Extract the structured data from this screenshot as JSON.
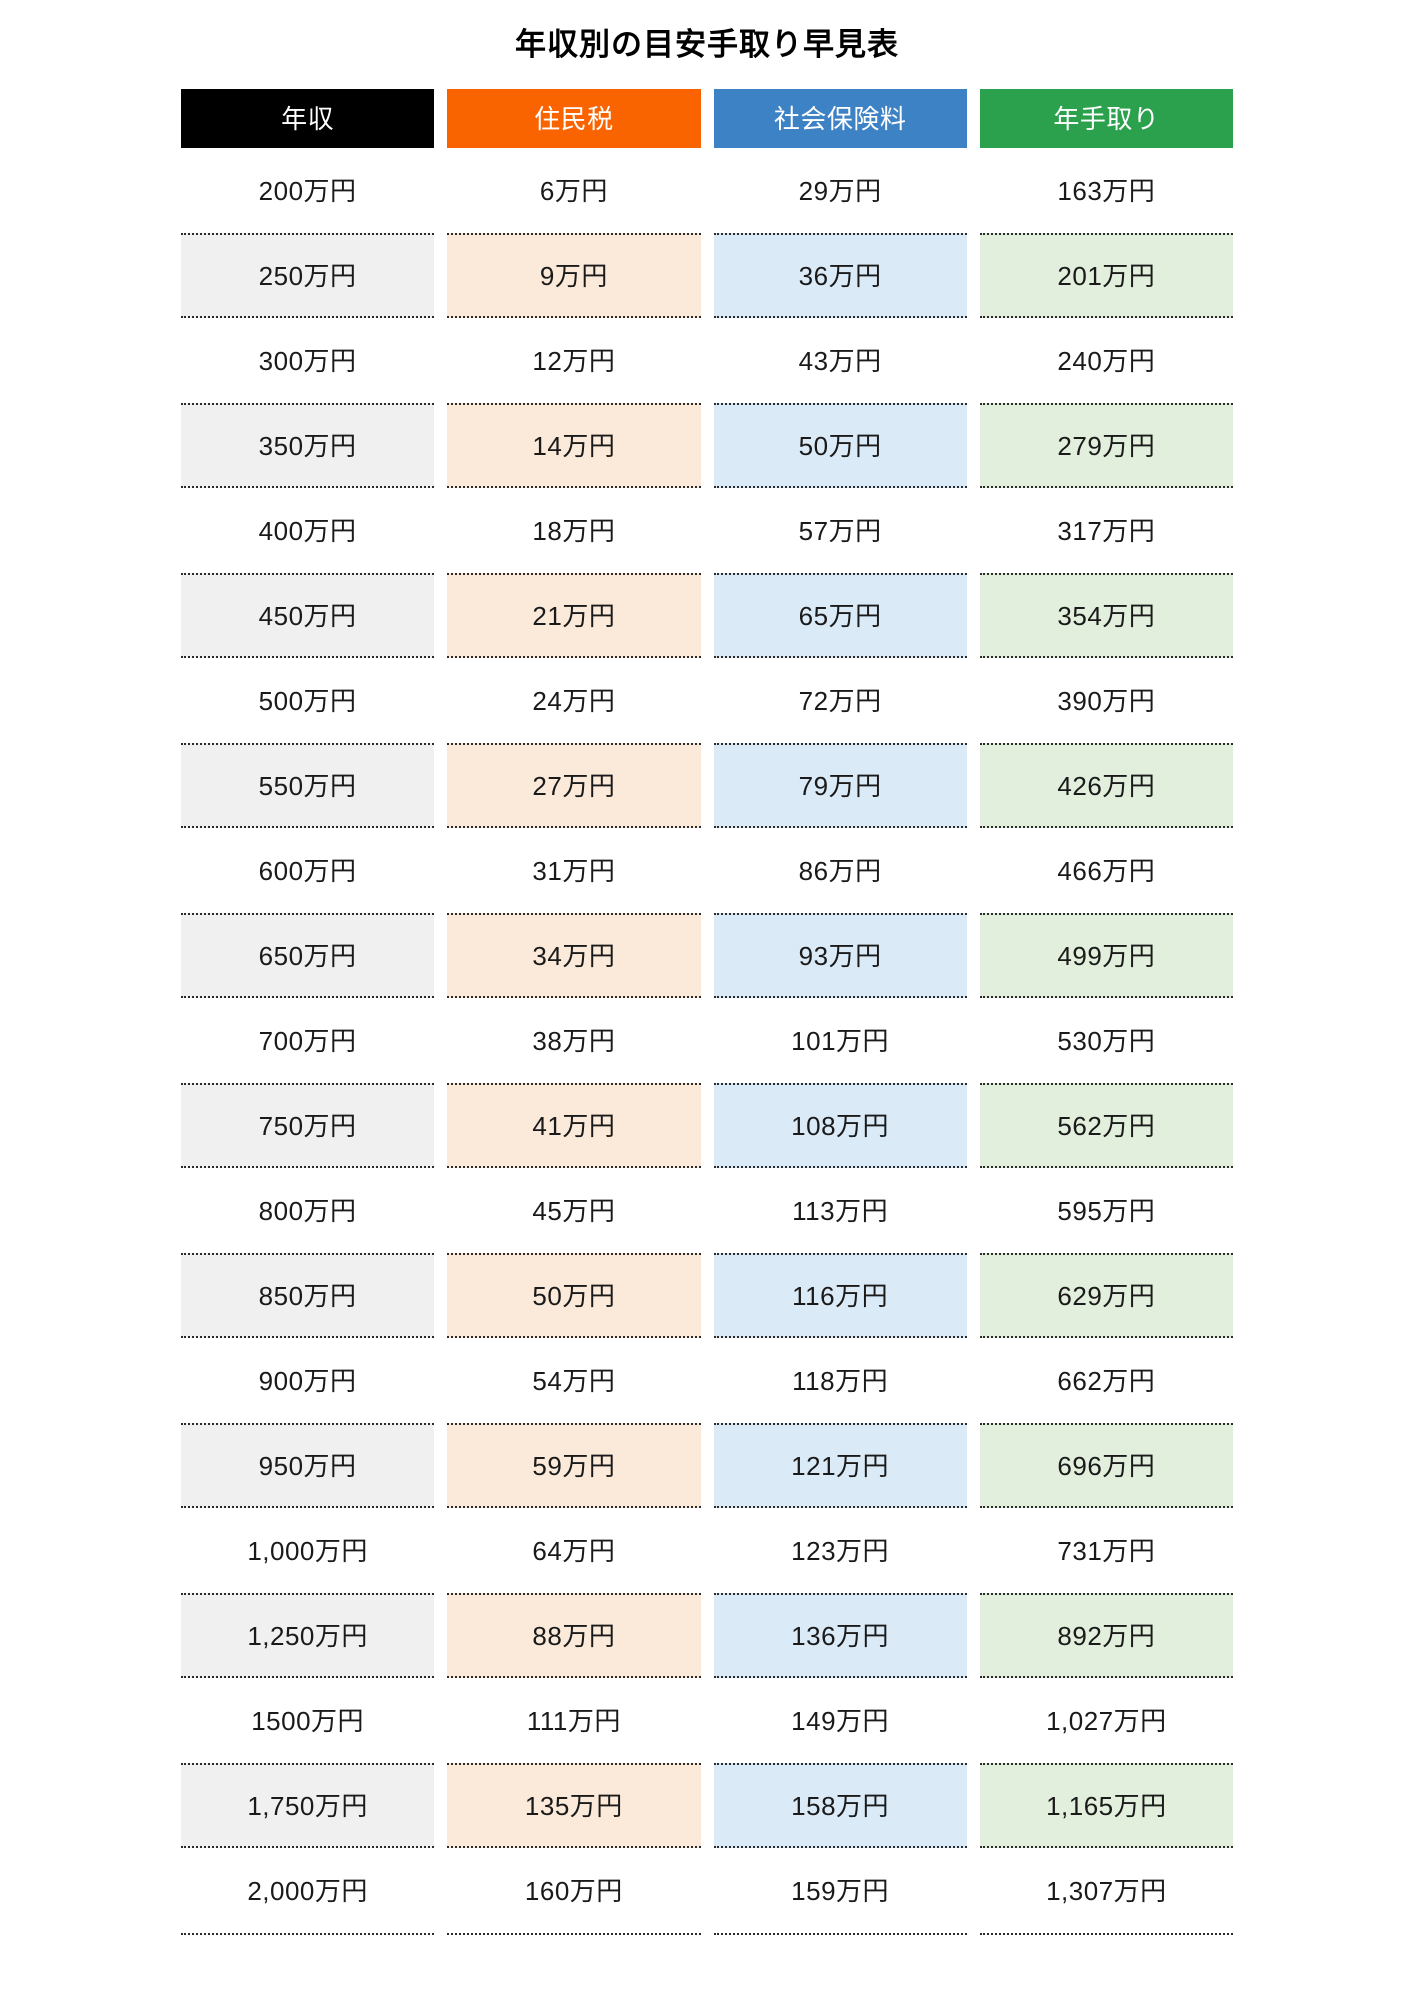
{
  "title": "年収別の目安手取り早見表",
  "colors": {
    "header_income": "#000000",
    "header_resident_tax": "#FA6400",
    "header_social_insurance": "#3C82C4",
    "header_takehome": "#2BA14E",
    "tint_income": "#f0f0f0",
    "tint_resident_tax": "#fbead9",
    "tint_social_insurance": "#dbeaf7",
    "tint_takehome": "#e2efdc",
    "text": "#1a1a1a",
    "background": "#ffffff"
  },
  "table": {
    "headers": [
      "年収",
      "住民税",
      "社会保険料",
      "年手取り"
    ],
    "rows": [
      [
        "200万円",
        "6万円",
        "29万円",
        "163万円"
      ],
      [
        "250万円",
        "9万円",
        "36万円",
        "201万円"
      ],
      [
        "300万円",
        "12万円",
        "43万円",
        "240万円"
      ],
      [
        "350万円",
        "14万円",
        "50万円",
        "279万円"
      ],
      [
        "400万円",
        "18万円",
        "57万円",
        "317万円"
      ],
      [
        "450万円",
        "21万円",
        "65万円",
        "354万円"
      ],
      [
        "500万円",
        "24万円",
        "72万円",
        "390万円"
      ],
      [
        "550万円",
        "27万円",
        "79万円",
        "426万円"
      ],
      [
        "600万円",
        "31万円",
        "86万円",
        "466万円"
      ],
      [
        "650万円",
        "34万円",
        "93万円",
        "499万円"
      ],
      [
        "700万円",
        "38万円",
        "101万円",
        "530万円"
      ],
      [
        "750万円",
        "41万円",
        "108万円",
        "562万円"
      ],
      [
        "800万円",
        "45万円",
        "113万円",
        "595万円"
      ],
      [
        "850万円",
        "50万円",
        "116万円",
        "629万円"
      ],
      [
        "900万円",
        "54万円",
        "118万円",
        "662万円"
      ],
      [
        "950万円",
        "59万円",
        "121万円",
        "696万円"
      ],
      [
        "1,000万円",
        "64万円",
        "123万円",
        "731万円"
      ],
      [
        "1,250万円",
        "88万円",
        "136万円",
        "892万円"
      ],
      [
        "1500万円",
        "111万円",
        "149万円",
        "1,027万円"
      ],
      [
        "1,750万円",
        "135万円",
        "158万円",
        "1,165万円"
      ],
      [
        "2,000万円",
        "160万円",
        "159万円",
        "1,307万円"
      ]
    ]
  },
  "chart_data": {
    "type": "table",
    "title": "年収別の目安手取り早見表",
    "columns": [
      "年収",
      "住民税",
      "社会保険料",
      "年手取り"
    ],
    "units": "万円",
    "series": [
      {
        "name": "年収",
        "values": [
          200,
          250,
          300,
          350,
          400,
          450,
          500,
          550,
          600,
          650,
          700,
          750,
          800,
          850,
          900,
          950,
          1000,
          1250,
          1500,
          1750,
          2000
        ]
      },
      {
        "name": "住民税",
        "values": [
          6,
          9,
          12,
          14,
          18,
          21,
          24,
          27,
          31,
          34,
          38,
          41,
          45,
          50,
          54,
          59,
          64,
          88,
          111,
          135,
          160
        ]
      },
      {
        "name": "社会保険料",
        "values": [
          29,
          36,
          43,
          50,
          57,
          65,
          72,
          79,
          86,
          93,
          101,
          108,
          113,
          116,
          118,
          121,
          123,
          136,
          149,
          158,
          159
        ]
      },
      {
        "name": "年手取り",
        "values": [
          163,
          201,
          240,
          279,
          317,
          354,
          390,
          426,
          466,
          499,
          530,
          562,
          595,
          629,
          662,
          696,
          731,
          892,
          1027,
          1165,
          1307
        ]
      }
    ]
  }
}
